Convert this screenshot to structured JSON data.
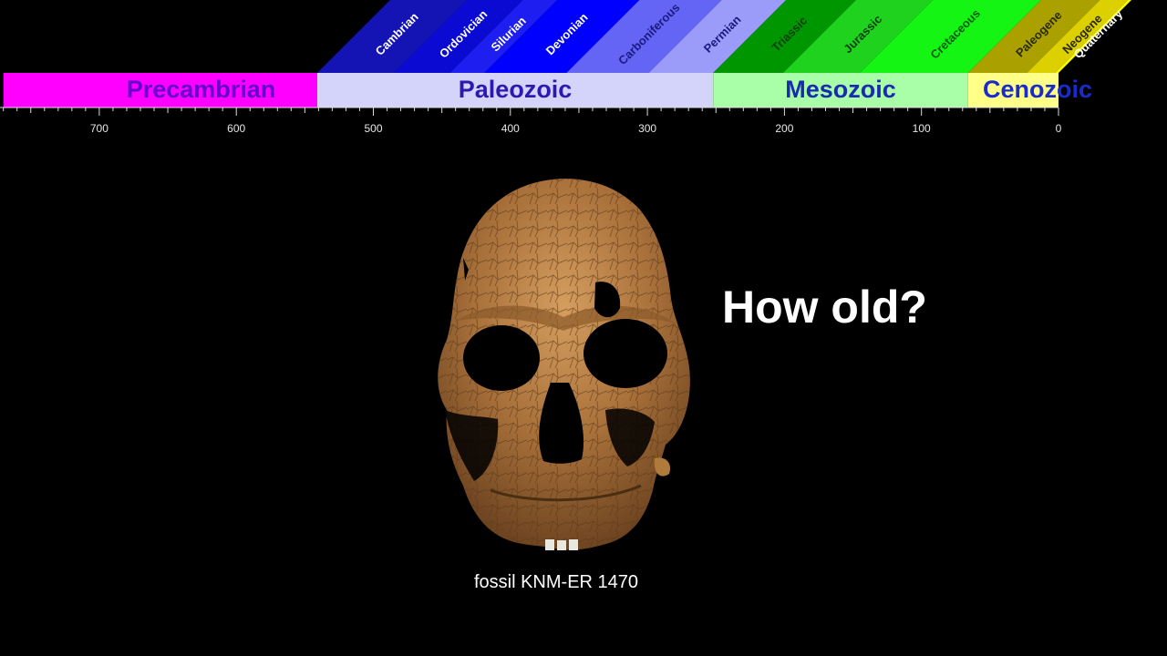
{
  "timeline": {
    "unit_note": "",
    "axis": {
      "min": 0,
      "max": 770,
      "reversed": true
    },
    "eras": [
      {
        "name": "Precambrian",
        "start": 770,
        "end": 541,
        "fill": "#ff00ff",
        "text_color": "#6600cc"
      },
      {
        "name": "Paleozoic",
        "start": 541,
        "end": 252,
        "fill": "#d4d4fa",
        "text_color": "#2b1ab0"
      },
      {
        "name": "Mesozoic",
        "start": 252,
        "end": 66,
        "fill": "#a8ffa8",
        "text_color": "#1a2bb0"
      },
      {
        "name": "Cenozoic",
        "start": 66,
        "end": 0,
        "fill": "#ffff88",
        "text_color": "#1a2bcc"
      }
    ],
    "periods": [
      {
        "name": "Cambrian",
        "start": 541,
        "end": 485,
        "fill": "#1414b4",
        "text_color": "#ffffff"
      },
      {
        "name": "Ordovician",
        "start": 485,
        "end": 444,
        "fill": "#0a0ad2",
        "text_color": "#ffffff"
      },
      {
        "name": "Silurian",
        "start": 444,
        "end": 419,
        "fill": "#1e1ef0",
        "text_color": "#ffffff"
      },
      {
        "name": "Devonian",
        "start": 419,
        "end": 359,
        "fill": "#0000ff",
        "text_color": "#ffffff"
      },
      {
        "name": "Carboniferous",
        "start": 359,
        "end": 299,
        "fill": "#6464f5",
        "text_color": "#1a1a80"
      },
      {
        "name": "Permian",
        "start": 299,
        "end": 252,
        "fill": "#9b9bfa",
        "text_color": "#1a1a80"
      },
      {
        "name": "Triassic",
        "start": 252,
        "end": 201,
        "fill": "#009600",
        "text_color": "#0a3d0a"
      },
      {
        "name": "Jurassic",
        "start": 201,
        "end": 145,
        "fill": "#1ed21e",
        "text_color": "#0a3d0a"
      },
      {
        "name": "Cretaceous",
        "start": 145,
        "end": 66,
        "fill": "#14f514",
        "text_color": "#0a5a0a"
      },
      {
        "name": "Paleogene",
        "start": 66,
        "end": 23,
        "fill": "#aaa000",
        "text_color": "#2a2a00"
      },
      {
        "name": "Neogene",
        "start": 23,
        "end": 2.6,
        "fill": "#dcd000",
        "text_color": "#2a2a00"
      },
      {
        "name": "Quaternary",
        "start": 2.6,
        "end": 0,
        "fill": "#fafa00",
        "text_color": "#ffffff"
      }
    ],
    "tick_labels": [
      {
        "value": 700,
        "label": "700"
      },
      {
        "value": 600,
        "label": "600"
      },
      {
        "value": 500,
        "label": "500"
      },
      {
        "value": 400,
        "label": "400"
      },
      {
        "value": 300,
        "label": "300"
      },
      {
        "value": 200,
        "label": "200"
      },
      {
        "value": 100,
        "label": "100"
      },
      {
        "value": 0,
        "label": "0"
      }
    ],
    "minor_tick_step": 10
  },
  "question": "How old?",
  "caption": "fossil KNM-ER 1470",
  "skull_icon": "fossil-skull-illustration",
  "colors": {
    "background": "#000000",
    "skull_bone": "#b07a3a",
    "skull_dark": "#6b4420",
    "skull_light": "#d9a466"
  }
}
